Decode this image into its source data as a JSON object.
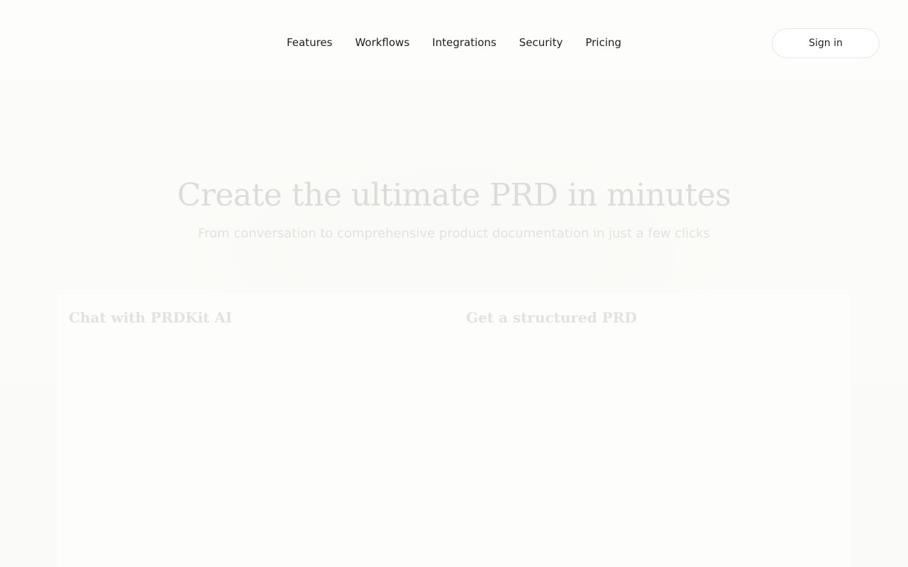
{
  "nav": {
    "items": [
      {
        "label": "Features"
      },
      {
        "label": "Workflows"
      },
      {
        "label": "Integrations"
      },
      {
        "label": "Security"
      },
      {
        "label": "Pricing"
      }
    ],
    "signin_label": "Sign in"
  },
  "hero": {
    "title": "Create the ultimate PRD in minutes",
    "subtitle": "From conversation to comprehensive product documentation in just a few clicks"
  },
  "panels": [
    {
      "title": "Chat with PRDKit AI"
    },
    {
      "title": "Get a structured PRD"
    }
  ]
}
